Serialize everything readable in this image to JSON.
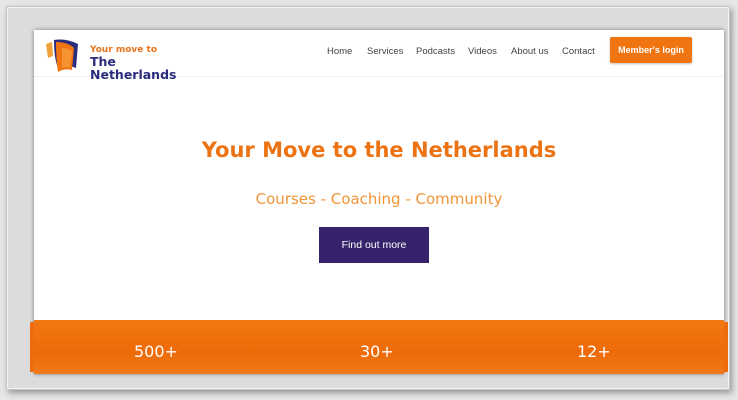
{
  "logo": {
    "line1": "Your move to",
    "line2": "The Netherlands",
    "icon": "logo-mark-icon"
  },
  "nav": {
    "items": [
      {
        "label": "Home"
      },
      {
        "label": "Services"
      },
      {
        "label": "Podcasts"
      },
      {
        "label": "Videos"
      },
      {
        "label": "About us"
      },
      {
        "label": "Contact"
      }
    ],
    "login_label": "Member's login"
  },
  "hero": {
    "title": "Your Move to the Netherlands",
    "subtitle": "Courses - Coaching - Community",
    "cta_label": "Find out more"
  },
  "stats": [
    {
      "value": "500+"
    },
    {
      "value": "30+"
    },
    {
      "value": "12+"
    }
  ],
  "colors": {
    "accent_orange": "#f07511",
    "brand_navy": "#2a2d7c",
    "cta_purple": "#36236b"
  }
}
